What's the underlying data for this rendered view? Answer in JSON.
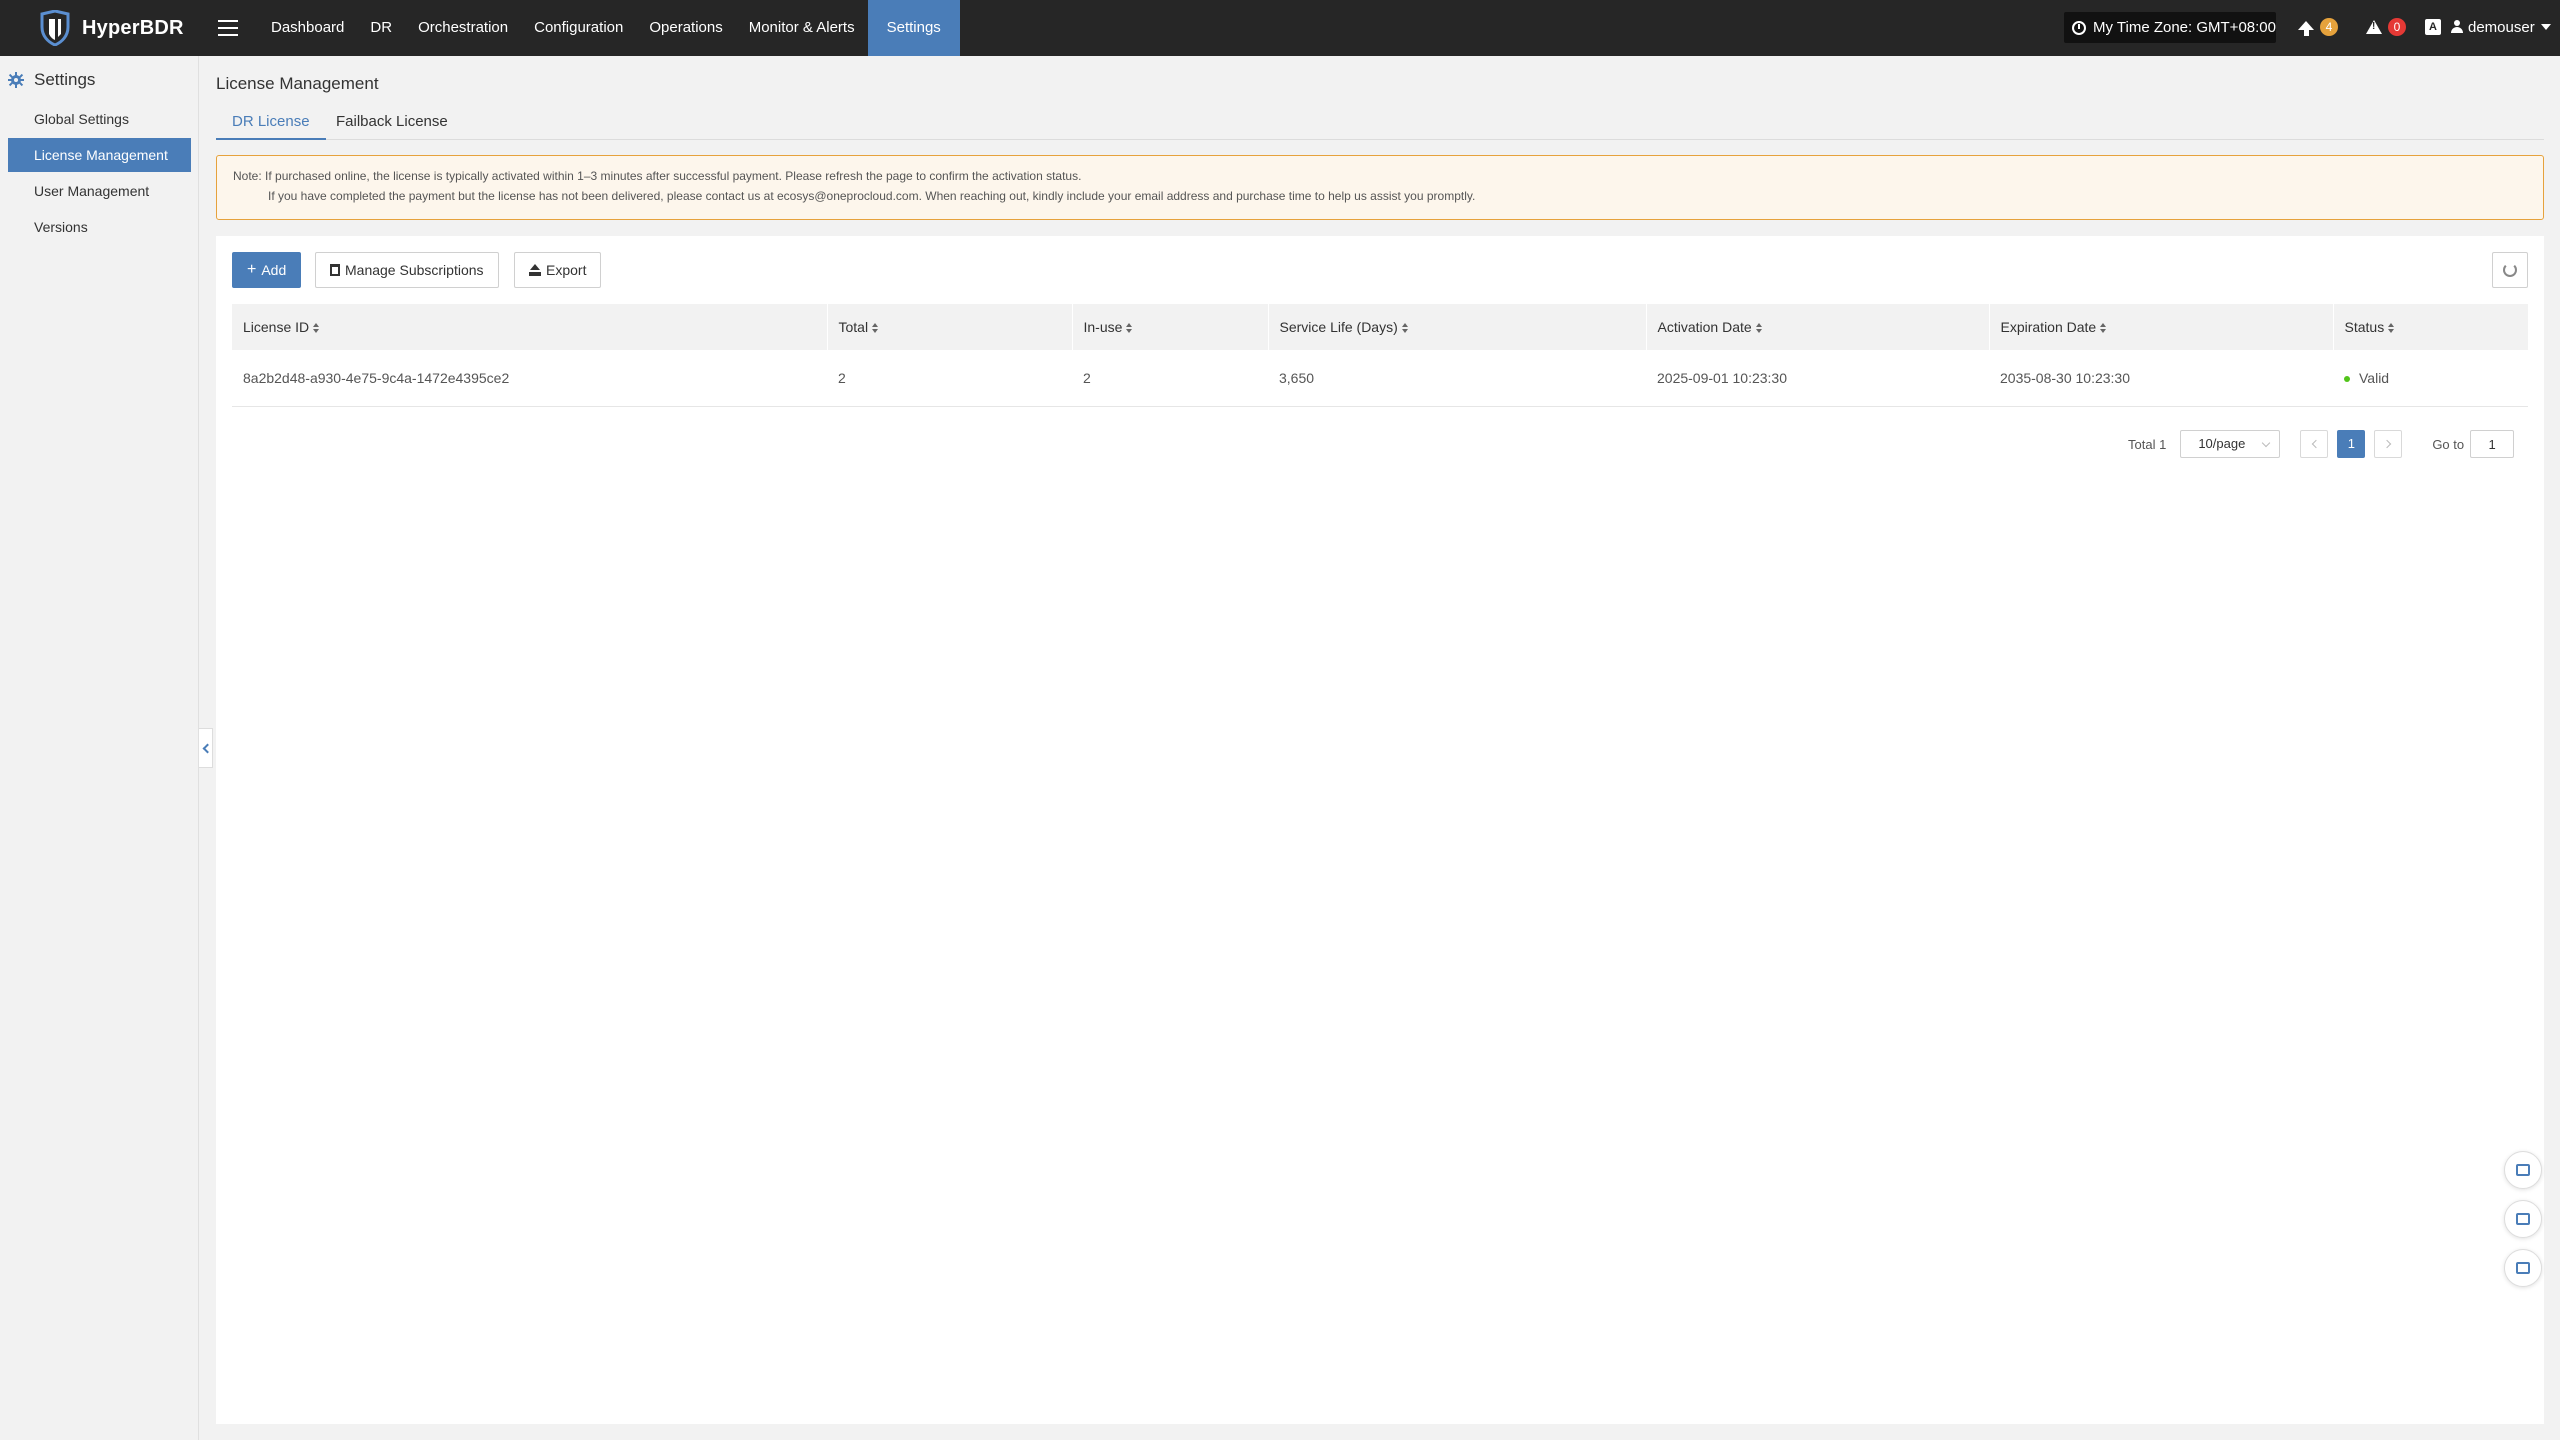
{
  "app": {
    "name": "HyperBDR",
    "brand_color": "#4a7db8"
  },
  "nav": {
    "items": [
      {
        "label": "Dashboard"
      },
      {
        "label": "DR"
      },
      {
        "label": "Orchestration"
      },
      {
        "label": "Configuration"
      },
      {
        "label": "Operations"
      },
      {
        "label": "Monitor & Alerts"
      },
      {
        "label": "Settings",
        "active": true
      }
    ]
  },
  "header": {
    "timezone": "My Time Zone: GMT+08:00",
    "upgrade_count": "4",
    "alert_count": "0",
    "lang_icon": "A",
    "username": "demouser"
  },
  "sidebar": {
    "title": "Settings",
    "items": [
      {
        "label": "Global Settings"
      },
      {
        "label": "License Management",
        "active": true
      },
      {
        "label": "User Management"
      },
      {
        "label": "Versions"
      }
    ]
  },
  "main": {
    "page_title": "License Management",
    "tabs": [
      {
        "label": "DR License",
        "active": true
      },
      {
        "label": "Failback License"
      }
    ],
    "notice": {
      "line1": "Note: If purchased online, the license is typically activated within 1–3 minutes after successful payment. Please refresh the page to confirm the activation status.",
      "line2": "If you have completed the payment but the license has not been delivered, please contact us at ecosys@oneprocloud.com. When reaching out, kindly include your email address and purchase time to help us assist you promptly."
    },
    "toolbar": {
      "add": "Add",
      "manage": "Manage Subscriptions",
      "export": "Export"
    },
    "table": {
      "columns": [
        "License ID",
        "Total",
        "In-use",
        "Service Life (Days)",
        "Activation Date",
        "Expiration Date",
        "Status"
      ],
      "rows": [
        {
          "license_id": "8a2b2d48-a930-4e75-9c4a-1472e4395ce2",
          "total": "2",
          "in_use": "2",
          "service_life": "3,650",
          "activation_date": "2025-09-01 10:23:30",
          "expiration_date": "2035-08-30 10:23:30",
          "status": "Valid",
          "status_color": "#52c41a"
        }
      ]
    },
    "pagination": {
      "total": "Total 1",
      "page_size": "10/page",
      "current_page": "1",
      "goto_label": "Go to",
      "goto_value": "1"
    }
  }
}
